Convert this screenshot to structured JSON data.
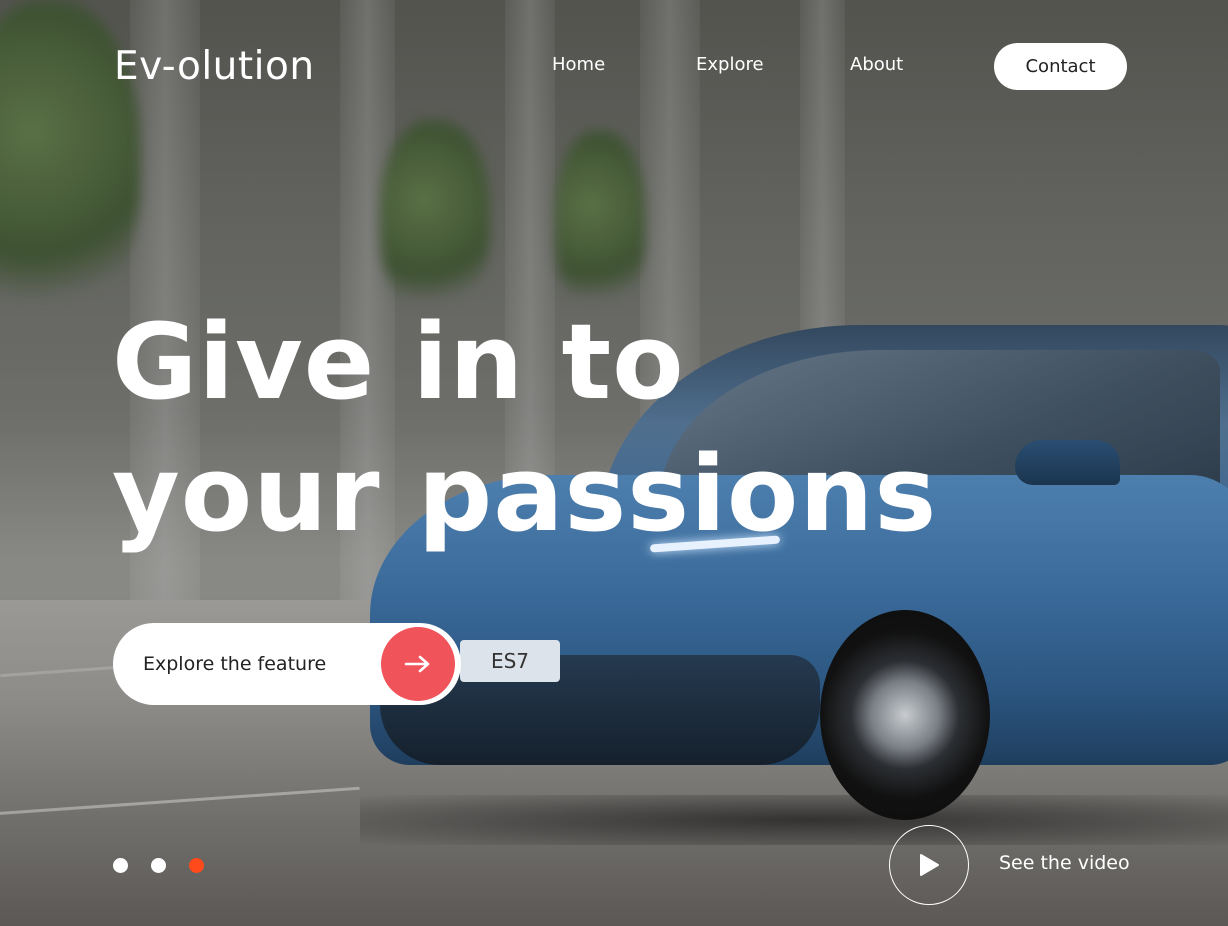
{
  "brand": {
    "logo": "Ev-olution"
  },
  "nav": {
    "items": [
      {
        "label": "Home"
      },
      {
        "label": "Explore"
      },
      {
        "label": "About"
      }
    ],
    "contact_label": "Contact"
  },
  "hero": {
    "headline_line1": "Give in to",
    "headline_line2": "your passions",
    "cta_label": "Explore the feature",
    "cta_icon": "arrow-right-icon",
    "plate_text": "ES7"
  },
  "slider": {
    "count": 3,
    "active_index": 2
  },
  "video": {
    "label": "See the video",
    "icon": "play-icon"
  },
  "colors": {
    "accent": "#f0545a",
    "active_dot": "#ff4a1c",
    "inactive_dot": "#ffffff",
    "car_blue": "#3a6a9a"
  }
}
